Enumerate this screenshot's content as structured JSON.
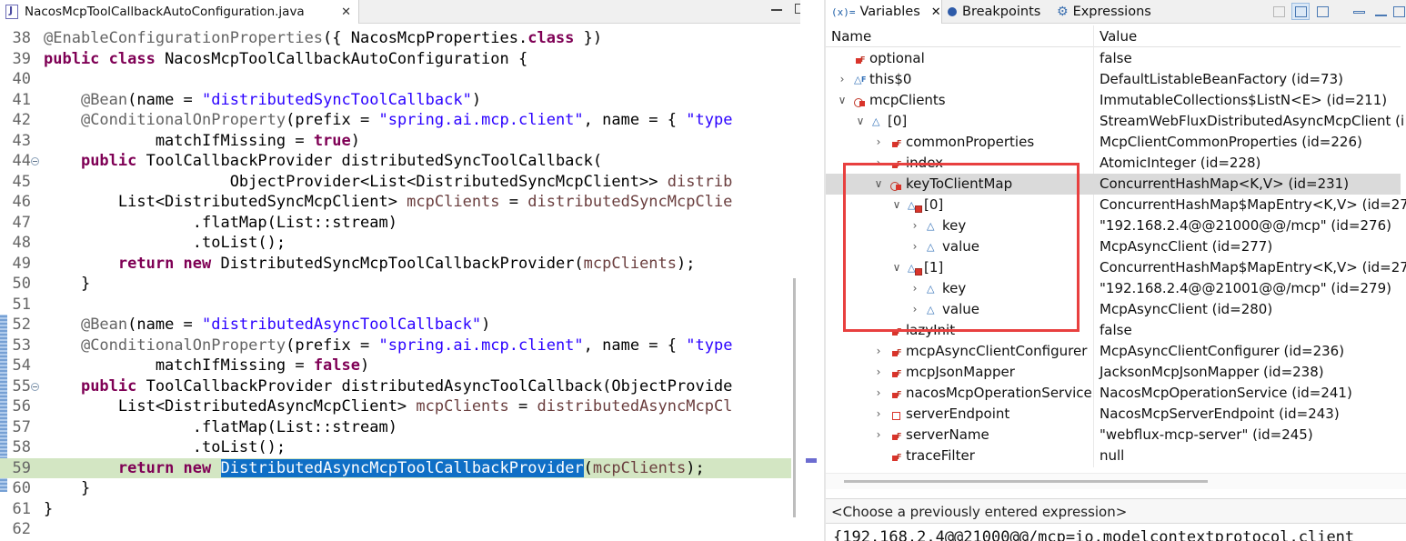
{
  "editor": {
    "tab_title": "NacosMcpToolCallbackAutoConfiguration.java",
    "close_glyph": "✕",
    "lines": [
      {
        "num": "38",
        "tokens": [
          {
            "t": "ann",
            "v": "@EnableConfigurationProperties"
          },
          {
            "t": "",
            "v": "({ NacosMcpProperties."
          },
          {
            "t": "kw",
            "v": "class"
          },
          {
            "t": "",
            "v": " })"
          }
        ]
      },
      {
        "num": "39",
        "tokens": [
          {
            "t": "kw",
            "v": "public class"
          },
          {
            "t": "",
            "v": " NacosMcpToolCallbackAutoConfiguration {"
          }
        ]
      },
      {
        "num": "40",
        "tokens": []
      },
      {
        "num": "41",
        "tokens": [
          {
            "t": "",
            "v": "    "
          },
          {
            "t": "ann",
            "v": "@Bean"
          },
          {
            "t": "",
            "v": "(name = "
          },
          {
            "t": "str",
            "v": "\"distributedSyncToolCallback\""
          },
          {
            "t": "",
            "v": ")"
          }
        ]
      },
      {
        "num": "42",
        "tokens": [
          {
            "t": "",
            "v": "    "
          },
          {
            "t": "ann",
            "v": "@ConditionalOnProperty"
          },
          {
            "t": "",
            "v": "(prefix = "
          },
          {
            "t": "str",
            "v": "\"spring.ai.mcp.client\""
          },
          {
            "t": "",
            "v": ", name = { "
          },
          {
            "t": "str",
            "v": "\"type"
          }
        ]
      },
      {
        "num": "43",
        "tokens": [
          {
            "t": "",
            "v": "            matchIfMissing = "
          },
          {
            "t": "kw",
            "v": "true"
          },
          {
            "t": "",
            "v": ")"
          }
        ]
      },
      {
        "num": "44",
        "fold": true,
        "tokens": [
          {
            "t": "",
            "v": "    "
          },
          {
            "t": "kw",
            "v": "public"
          },
          {
            "t": "",
            "v": " ToolCallbackProvider distributedSyncToolCallback("
          }
        ]
      },
      {
        "num": "45",
        "tokens": [
          {
            "t": "",
            "v": "                    ObjectProvider<List<DistributedSyncMcpClient>> "
          },
          {
            "t": "fld",
            "v": "distrib"
          }
        ]
      },
      {
        "num": "46",
        "tokens": [
          {
            "t": "",
            "v": "        List<DistributedSyncMcpClient> "
          },
          {
            "t": "fld",
            "v": "mcpClients"
          },
          {
            "t": "",
            "v": " = "
          },
          {
            "t": "fld",
            "v": "distributedSyncMcpClie"
          }
        ]
      },
      {
        "num": "47",
        "tokens": [
          {
            "t": "",
            "v": "                .flatMap(List::stream)"
          }
        ]
      },
      {
        "num": "48",
        "tokens": [
          {
            "t": "",
            "v": "                .toList();"
          }
        ]
      },
      {
        "num": "49",
        "tokens": [
          {
            "t": "",
            "v": "        "
          },
          {
            "t": "kw",
            "v": "return new"
          },
          {
            "t": "",
            "v": " DistributedSyncMcpToolCallbackProvider("
          },
          {
            "t": "fld",
            "v": "mcpClients"
          },
          {
            "t": "",
            "v": ");"
          }
        ]
      },
      {
        "num": "50",
        "tokens": [
          {
            "t": "",
            "v": "    }"
          }
        ]
      },
      {
        "num": "51",
        "tokens": []
      },
      {
        "num": "52",
        "tokens": [
          {
            "t": "",
            "v": "    "
          },
          {
            "t": "ann",
            "v": "@Bean"
          },
          {
            "t": "",
            "v": "(name = "
          },
          {
            "t": "str",
            "v": "\"distributedAsyncToolCallback\""
          },
          {
            "t": "",
            "v": ")"
          }
        ]
      },
      {
        "num": "53",
        "tokens": [
          {
            "t": "",
            "v": "    "
          },
          {
            "t": "ann",
            "v": "@ConditionalOnProperty"
          },
          {
            "t": "",
            "v": "(prefix = "
          },
          {
            "t": "str",
            "v": "\"spring.ai.mcp.client\""
          },
          {
            "t": "",
            "v": ", name = { "
          },
          {
            "t": "str",
            "v": "\"type"
          }
        ]
      },
      {
        "num": "54",
        "tokens": [
          {
            "t": "",
            "v": "            matchIfMissing = "
          },
          {
            "t": "kw",
            "v": "false"
          },
          {
            "t": "",
            "v": ")"
          }
        ]
      },
      {
        "num": "55",
        "fold": true,
        "tokens": [
          {
            "t": "",
            "v": "    "
          },
          {
            "t": "kw",
            "v": "public"
          },
          {
            "t": "",
            "v": " ToolCallbackProvider distributedAsyncToolCallback(ObjectProvide"
          }
        ]
      },
      {
        "num": "56",
        "tokens": [
          {
            "t": "",
            "v": "        List<DistributedAsyncMcpClient> "
          },
          {
            "t": "fld",
            "v": "mcpClients"
          },
          {
            "t": "",
            "v": " = "
          },
          {
            "t": "fld",
            "v": "distributedAsyncMcpCl"
          }
        ]
      },
      {
        "num": "57",
        "tokens": [
          {
            "t": "",
            "v": "                .flatMap(List::stream)"
          }
        ]
      },
      {
        "num": "58",
        "tokens": [
          {
            "t": "",
            "v": "                .toList();"
          }
        ]
      },
      {
        "num": "59",
        "current": true,
        "tokens": [
          {
            "t": "",
            "v": "        "
          },
          {
            "t": "kw",
            "v": "return new"
          },
          {
            "t": "",
            "v": " "
          },
          {
            "t": "sel",
            "v": "DistributedAsyncMcpToolCallbackProvider"
          },
          {
            "t": "",
            "v": "("
          },
          {
            "t": "fld",
            "v": "mcpClients"
          },
          {
            "t": "",
            "v": ");"
          }
        ]
      },
      {
        "num": "60",
        "tokens": [
          {
            "t": "",
            "v": "    }"
          }
        ]
      },
      {
        "num": "61",
        "tokens": [
          {
            "t": "",
            "v": "}"
          }
        ]
      },
      {
        "num": "62",
        "tokens": []
      }
    ]
  },
  "variables_view": {
    "tabs": {
      "variables": {
        "icon": "(x)=",
        "label": "Variables",
        "close": "✕"
      },
      "breakpoints": {
        "label": "Breakpoints"
      },
      "expressions": {
        "icon": "⚙",
        "label": "Expressions"
      }
    },
    "columns": {
      "name": "Name",
      "value": "Value"
    },
    "rows": [
      {
        "indent": 0,
        "twisty": "",
        "icon": "field",
        "name": "optional",
        "value": "false"
      },
      {
        "indent": 0,
        "twisty": ">",
        "icon": "tri-f",
        "name": "this$0",
        "value": "DefaultListableBeanFactory  (id=73)"
      },
      {
        "indent": 0,
        "twisty": "v",
        "icon": "map",
        "name": "mcpClients",
        "value": "ImmutableCollections$ListN<E>  (id=211)"
      },
      {
        "indent": 1,
        "twisty": "v",
        "icon": "tri",
        "name": "[0]",
        "value": "StreamWebFluxDistributedAsyncMcpClient  (i"
      },
      {
        "indent": 2,
        "twisty": ">",
        "icon": "field",
        "name": "commonProperties",
        "value": "McpClientCommonProperties  (id=226)"
      },
      {
        "indent": 2,
        "twisty": ">",
        "icon": "field",
        "name": "index",
        "value": "AtomicInteger  (id=228)"
      },
      {
        "indent": 2,
        "twisty": "v",
        "icon": "map",
        "name": "keyToClientMap",
        "value": "ConcurrentHashMap<K,V>  (id=231)",
        "selected": true
      },
      {
        "indent": 3,
        "twisty": "v",
        "icon": "entry",
        "name": "[0]",
        "value": "ConcurrentHashMap$MapEntry<K,V>  (id=27"
      },
      {
        "indent": 4,
        "twisty": ">",
        "icon": "tri",
        "name": "key",
        "value": "\"192.168.2.4@@21000@@/mcp\" (id=276)"
      },
      {
        "indent": 4,
        "twisty": ">",
        "icon": "tri",
        "name": "value",
        "value": "McpAsyncClient  (id=277)"
      },
      {
        "indent": 3,
        "twisty": "v",
        "icon": "entry",
        "name": "[1]",
        "value": "ConcurrentHashMap$MapEntry<K,V>  (id=27"
      },
      {
        "indent": 4,
        "twisty": ">",
        "icon": "tri",
        "name": "key",
        "value": "\"192.168.2.4@@21001@@/mcp\" (id=279)"
      },
      {
        "indent": 4,
        "twisty": ">",
        "icon": "tri",
        "name": "value",
        "value": "McpAsyncClient  (id=280)"
      },
      {
        "indent": 2,
        "twisty": "",
        "icon": "field",
        "name": "lazyInit",
        "value": "false"
      },
      {
        "indent": 2,
        "twisty": ">",
        "icon": "field",
        "name": "mcpAsyncClientConfigurer",
        "value": "McpAsyncClientConfigurer  (id=236)"
      },
      {
        "indent": 2,
        "twisty": ">",
        "icon": "field",
        "name": "mcpJsonMapper",
        "value": "JacksonMcpJsonMapper  (id=238)"
      },
      {
        "indent": 2,
        "twisty": ">",
        "icon": "field",
        "name": "nacosMcpOperationService",
        "value": "NacosMcpOperationService  (id=241)"
      },
      {
        "indent": 2,
        "twisty": ">",
        "icon": "sq",
        "name": "serverEndpoint",
        "value": "NacosMcpServerEndpoint  (id=243)"
      },
      {
        "indent": 2,
        "twisty": ">",
        "icon": "field",
        "name": "serverName",
        "value": "\"webflux-mcp-server\" (id=245)"
      },
      {
        "indent": 2,
        "twisty": "",
        "icon": "field",
        "name": "traceFilter",
        "value": "null"
      }
    ],
    "expression_placeholder": "<Choose a previously entered expression>",
    "detail_text": "{192.168.2.4@@21000@@/mcp=io.modelcontextprotocol.client"
  }
}
